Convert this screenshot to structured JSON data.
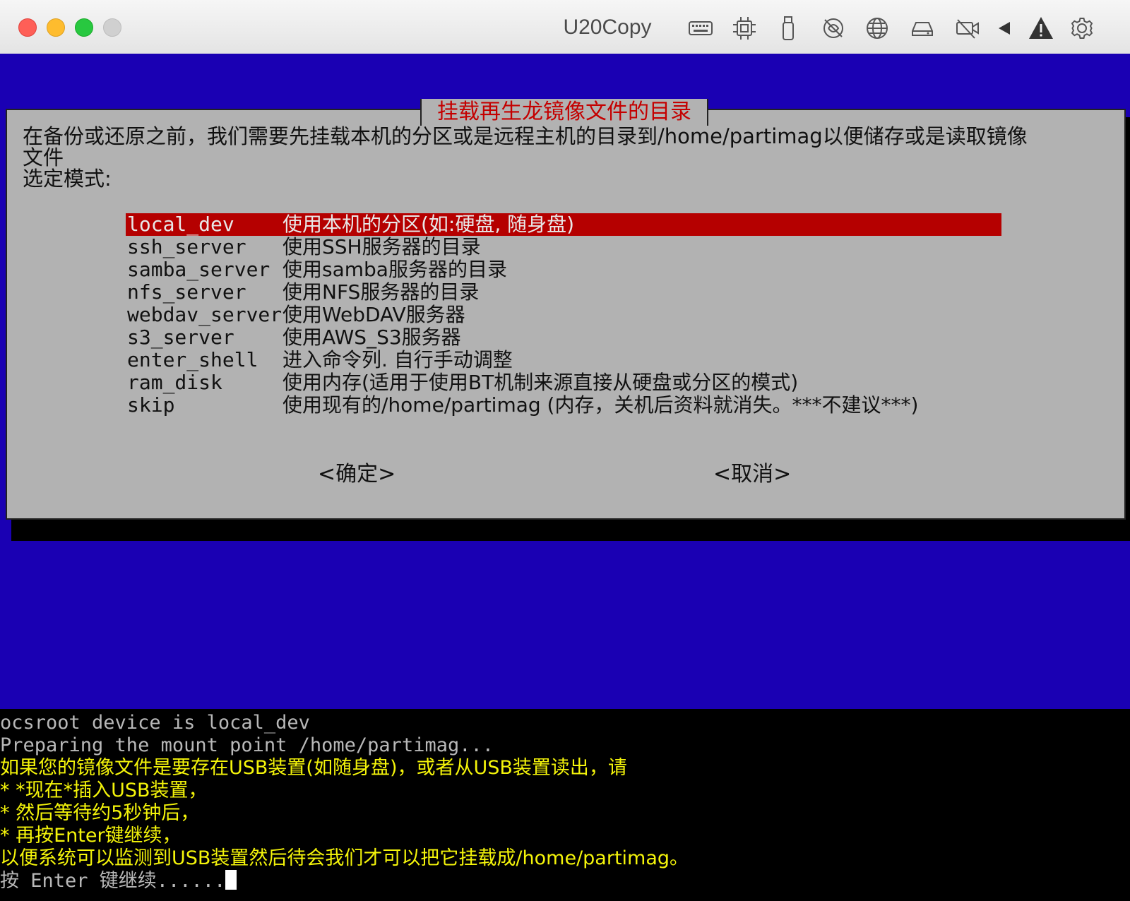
{
  "window": {
    "title": "U20Copy",
    "toolbar_icons": [
      "keyboard-icon",
      "cpu-icon",
      "usb-icon",
      "network-off-icon",
      "globe-icon",
      "disk-icon",
      "camera-off-icon",
      "play-back-icon",
      "warning-icon",
      "gear-icon"
    ]
  },
  "dialog": {
    "title": "挂载再生龙镜像文件的目录",
    "prompt_lines": [
      "在备份或还原之前，我们需要先挂载本机的分区或是远程主机的目录到/home/partimag以便储存或是读取镜像",
      "文件",
      "选定模式:"
    ],
    "menu": [
      {
        "key": "local_dev",
        "desc": "使用本机的分区(如:硬盘, 随身盘)",
        "selected": true
      },
      {
        "key": "ssh_server",
        "desc": "使用SSH服务器的目录",
        "selected": false
      },
      {
        "key": "samba_server",
        "desc": "使用samba服务器的目录",
        "selected": false
      },
      {
        "key": "nfs_server",
        "desc": "使用NFS服务器的目录",
        "selected": false
      },
      {
        "key": "webdav_server",
        "desc": "使用WebDAV服务器",
        "selected": false
      },
      {
        "key": "s3_server",
        "desc": "使用AWS_S3服务器",
        "selected": false
      },
      {
        "key": "enter_shell",
        "desc": "进入命令列. 自行手动调整",
        "selected": false
      },
      {
        "key": "ram_disk",
        "desc": "使用内存(适用于使用BT机制来源直接从硬盘或分区的模式)",
        "selected": false
      },
      {
        "key": "skip",
        "desc": "使用现有的/home/partimag (内存，关机后资料就消失。***不建议***)",
        "selected": false
      }
    ],
    "ok_label": "<确定>",
    "cancel_label": "<取消>"
  },
  "console": {
    "lines": [
      {
        "text": "ocsroot device is local_dev",
        "color": "gray"
      },
      {
        "text": "Preparing the mount point /home/partimag...",
        "color": "gray"
      },
      {
        "text": "如果您的镜像文件是要存在USB装置(如随身盘)，或者从USB装置读出，请",
        "color": "yellow"
      },
      {
        "text": " * *现在*插入USB装置，",
        "color": "yellow"
      },
      {
        "text": " * 然后等待约5秒钟后，",
        "color": "yellow"
      },
      {
        "text": " * 再按Enter键继续，",
        "color": "yellow"
      },
      {
        "text": "以便系统可以监测到USB装置然后待会我们才可以把它挂载成/home/partimag。",
        "color": "yellow"
      },
      {
        "text": "按 Enter 键继续......",
        "color": "gray"
      }
    ]
  },
  "colors": {
    "screen_bg": "#1a00b3",
    "dialog_bg": "#b2b2b2",
    "title_red": "#c40000",
    "selection_bg": "#b50000",
    "console_yellow": "#f4f40a",
    "console_gray": "#b8b8b8"
  }
}
